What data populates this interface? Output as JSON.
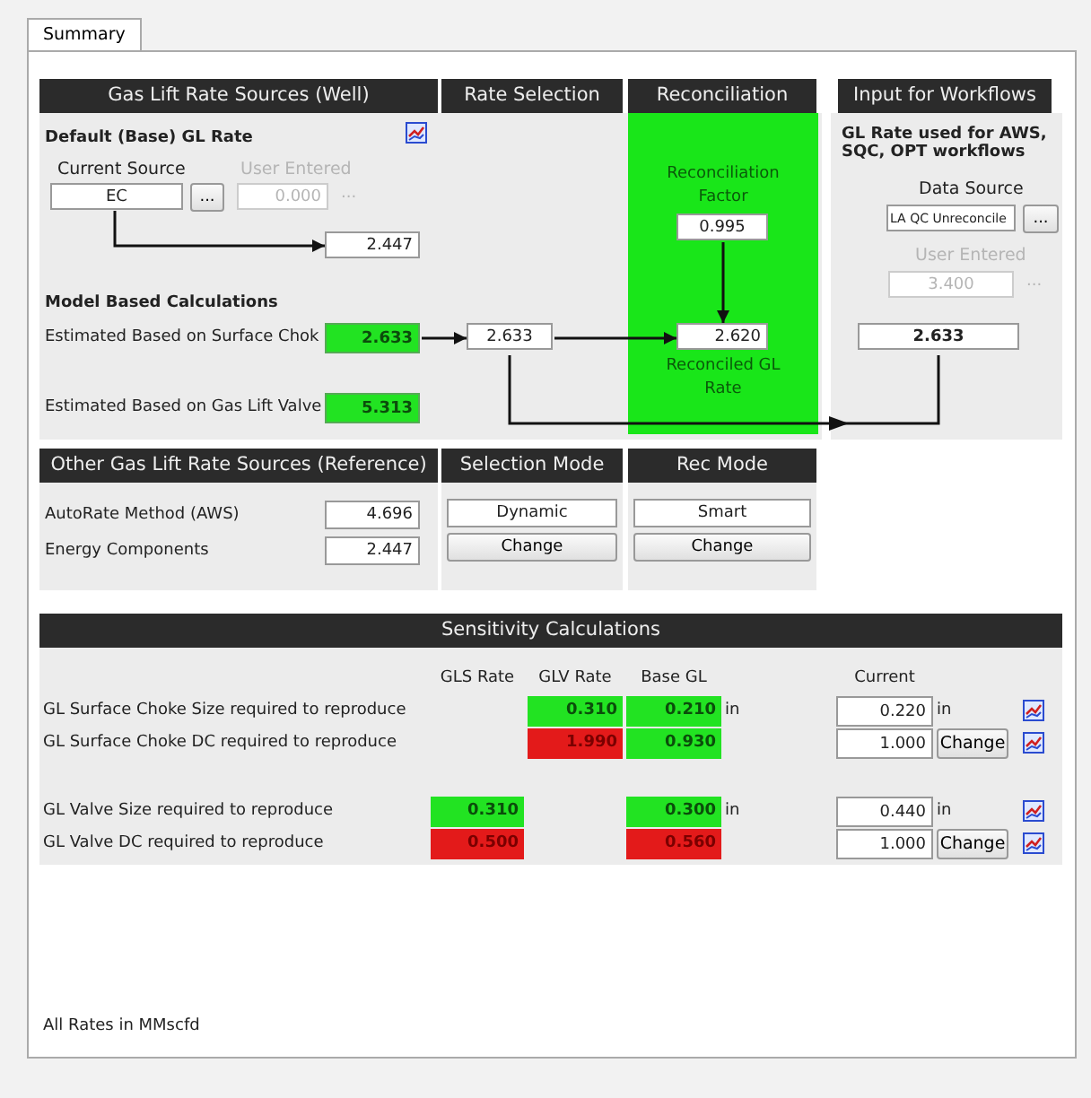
{
  "tab": {
    "label": "Summary",
    "selected": true
  },
  "sources": {
    "title": "Gas Lift Rate Sources (Well)",
    "default_heading": "Default (Base) GL Rate",
    "current_source": {
      "label": "Current Source",
      "value": "EC",
      "button": "..."
    },
    "user_entered": {
      "label": "User Entered",
      "value": "0.000",
      "disabled": true,
      "more": "..."
    },
    "default_rate": "2.447",
    "model_heading": "Model Based Calculations",
    "estimates": [
      {
        "label": "Estimated Based on Surface Chok",
        "value": "2.633",
        "color": "#22e322"
      },
      {
        "label": "Estimated Based on Gas Lift Valve",
        "value": "5.313",
        "color": "#22e322"
      }
    ]
  },
  "rate_selection": {
    "title": "Rate Selection",
    "value": "2.633"
  },
  "reconciliation": {
    "title": "Reconciliation",
    "factor_label": "Reconciliation Factor",
    "factor": "0.995",
    "rate": "2.620",
    "rate_label": "Reconciled GL Rate"
  },
  "workflows": {
    "title": "Input for Workflows",
    "heading": "GL Rate used for AWS, SQC, OPT workflows",
    "data_source": {
      "label": "Data Source",
      "value": "LA QC Unreconcile",
      "button": "..."
    },
    "user_entered": {
      "label": "User Entered",
      "value": "3.400",
      "disabled": true,
      "more": "..."
    },
    "value": "2.633"
  },
  "other_sources": {
    "title": "Other Gas Lift Rate Sources (Reference)",
    "rows": [
      {
        "label": "AutoRate Method (AWS)",
        "value": "4.696"
      },
      {
        "label": "Energy Components",
        "value": "2.447"
      }
    ]
  },
  "selection_mode": {
    "title": "Selection Mode",
    "value": "Dynamic",
    "button": "Change"
  },
  "rec_mode": {
    "title": "Rec Mode",
    "value": "Smart",
    "button": "Change"
  },
  "sensitivity": {
    "title": "Sensitivity Calculations",
    "columns": [
      "GLS Rate",
      "GLV Rate",
      "Base GL",
      "Current"
    ],
    "groups": [
      [
        {
          "label": "GL Surface Choke Size required to reproduce",
          "glv": {
            "value": "0.310",
            "color": "#22e322"
          },
          "base": {
            "value": "0.210",
            "color": "#22e322"
          },
          "base_unit": "in",
          "current": "0.220",
          "current_unit": "in"
        },
        {
          "label": "GL Surface Choke DC required to reproduce",
          "glv": {
            "value": "1.990",
            "color": "#e31a1a"
          },
          "base": {
            "value": "0.930",
            "color": "#22e322"
          },
          "current": "1.000",
          "button": "Change"
        }
      ],
      [
        {
          "label": "GL Valve Size required to reproduce",
          "gls": {
            "value": "0.310",
            "color": "#22e322"
          },
          "base": {
            "value": "0.300",
            "color": "#22e322"
          },
          "base_unit": "in",
          "current": "0.440",
          "current_unit": "in"
        },
        {
          "label": "GL Valve DC required to reproduce",
          "gls": {
            "value": "0.500",
            "color": "#e31a1a"
          },
          "base": {
            "value": "0.560",
            "color": "#e31a1a"
          },
          "current": "1.000",
          "button": "Change"
        }
      ]
    ]
  },
  "footer": "All Rates in MMscfd"
}
